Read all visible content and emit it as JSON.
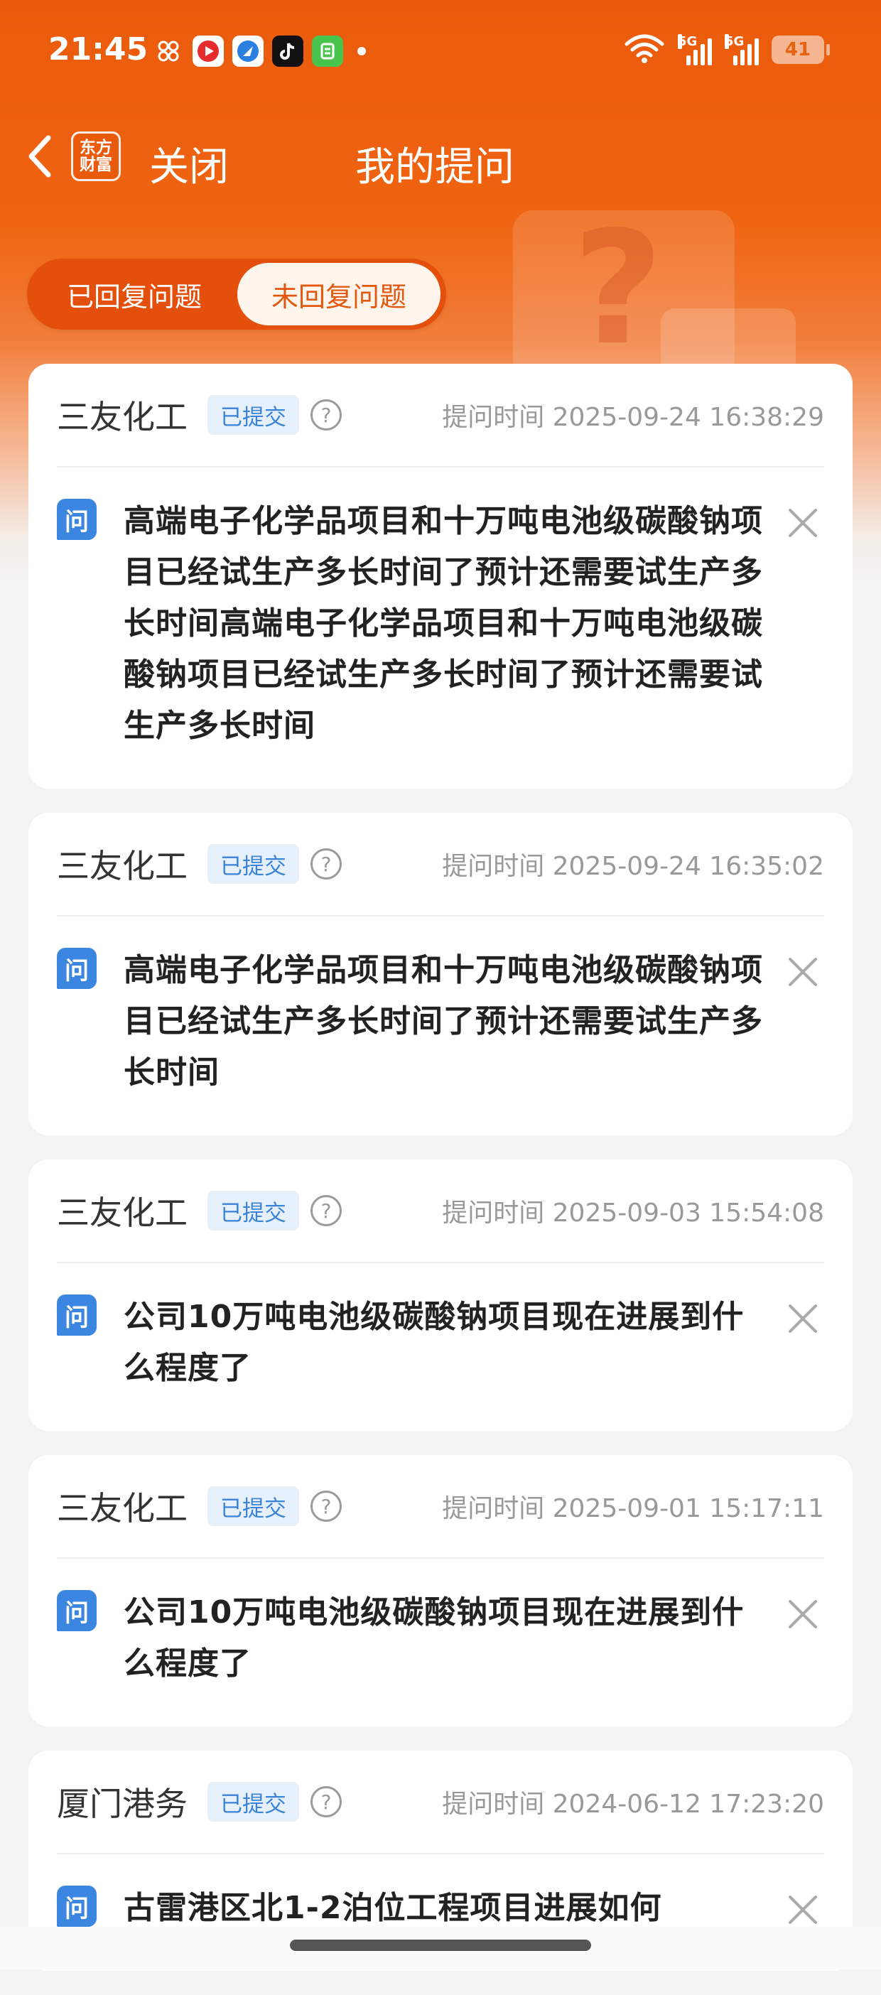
{
  "status_bar": {
    "time": "21:45",
    "net1": "5G",
    "net2": "5G",
    "battery": "41"
  },
  "nav": {
    "logo_line1": "东方",
    "logo_line2": "财富",
    "close_label": "关闭",
    "title": "我的提问"
  },
  "tabs": {
    "replied": "已回复问题",
    "unreplied": "未回复问题",
    "active": "未回复问题"
  },
  "questions": [
    {
      "company": "三友化工",
      "status": "已提交",
      "time": "提问时间 2025-09-24 16:38:29",
      "q_icon": "问",
      "text": "高端电子化学品项目和十万吨电池级碳酸钠项目已经试生产多长时间了预计还需要试生产多长时间高端电子化学品项目和十万吨电池级碳酸钠项目已经试生产多长时间了预计还需要试生产多长时间"
    },
    {
      "company": "三友化工",
      "status": "已提交",
      "time": "提问时间 2025-09-24 16:35:02",
      "q_icon": "问",
      "text": "高端电子化学品项目和十万吨电池级碳酸钠项目已经试生产多长时间了预计还需要试生产多长时间"
    },
    {
      "company": "三友化工",
      "status": "已提交",
      "time": "提问时间 2025-09-03 15:54:08",
      "q_icon": "问",
      "text": "公司10万吨电池级碳酸钠项目现在进展到什么程度了"
    },
    {
      "company": "三友化工",
      "status": "已提交",
      "time": "提问时间 2025-09-01 15:17:11",
      "q_icon": "问",
      "text": "公司10万吨电池级碳酸钠项目现在进展到什么程度了"
    },
    {
      "company": "厦门港务",
      "status": "已提交",
      "time": "提问时间 2024-06-12 17:23:20",
      "q_icon": "问",
      "text": "古雷港区北1-2泊位工程项目进展如何"
    }
  ],
  "colors": {
    "brand": "#ea5a0c",
    "badge_text": "#3a83d6",
    "q_icon": "#3a86e0"
  }
}
